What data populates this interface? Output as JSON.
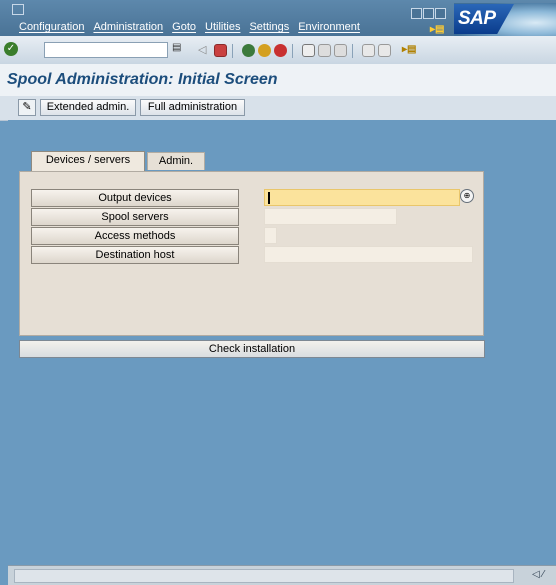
{
  "menubar": {
    "items": [
      "Configuration",
      "Administration",
      "Goto",
      "Utilities",
      "Settings",
      "Environment"
    ],
    "brand": "SAP"
  },
  "toolbar": {
    "command_field_value": "",
    "icons": [
      "enter-icon",
      "save-icon",
      "back-icon",
      "exit-icon",
      "cancel-icon",
      "print-icon",
      "find-icon",
      "find-next-icon",
      "first-page-icon",
      "last-page-icon",
      "menu-icon"
    ]
  },
  "title": "Spool Administration: Initial Screen",
  "app_toolbar": {
    "edit_icon": "pencil-icon",
    "buttons": [
      "Extended admin.",
      "Full administration"
    ]
  },
  "tabs": [
    {
      "label": "Devices / servers",
      "active": true
    },
    {
      "label": "Admin.",
      "active": false
    }
  ],
  "panel": {
    "rows": [
      {
        "label": "Output devices",
        "value": ""
      },
      {
        "label": "Spool servers",
        "value": ""
      },
      {
        "label": "Access methods",
        "value": ""
      },
      {
        "label": "Destination host",
        "value": ""
      }
    ]
  },
  "check_button": "Check installation",
  "status": {
    "message": ""
  },
  "colors": {
    "accent_title": "#1c4d7c",
    "focus_field": "#fbe39c",
    "background": "#6a9ac0"
  }
}
